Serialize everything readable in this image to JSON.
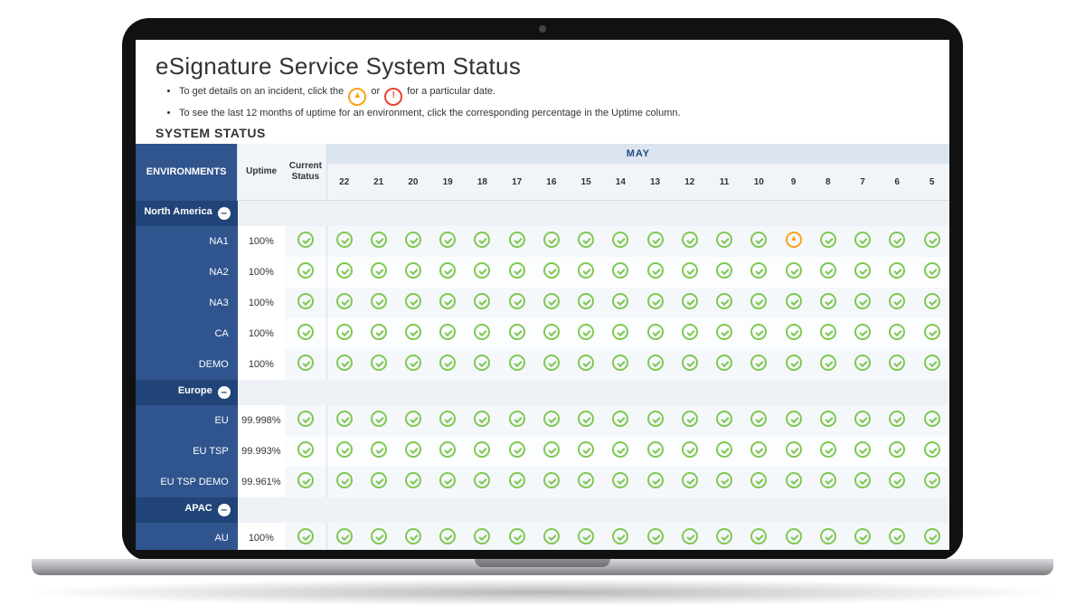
{
  "title": "eSignature Service System Status",
  "tips": [
    {
      "before": "To get details on an incident, click the ",
      "mid": " or ",
      "after": " for a particular date."
    },
    {
      "text": "To see the last 12 months of uptime for an environment, click the corresponding percentage in the Uptime column."
    }
  ],
  "section_label": "SYSTEM STATUS",
  "headers": {
    "environments": "ENVIRONMENTS",
    "uptime": "Uptime",
    "current_status": "Current Status",
    "month": "MAY"
  },
  "days": [
    "22",
    "21",
    "20",
    "19",
    "18",
    "17",
    "16",
    "15",
    "14",
    "13",
    "12",
    "11",
    "10",
    "9",
    "8",
    "7",
    "6",
    "5"
  ],
  "icons": {
    "ok": "ok",
    "warn": "warn"
  },
  "rows": [
    {
      "type": "region",
      "label": "North America"
    },
    {
      "type": "env",
      "label": "NA1",
      "uptime": "100%",
      "current": "ok",
      "cells": [
        "ok",
        "ok",
        "ok",
        "ok",
        "ok",
        "ok",
        "ok",
        "ok",
        "ok",
        "ok",
        "ok",
        "ok",
        "ok",
        "warn",
        "ok",
        "ok",
        "ok",
        "ok"
      ]
    },
    {
      "type": "env",
      "label": "NA2",
      "uptime": "100%",
      "current": "ok",
      "cells": [
        "ok",
        "ok",
        "ok",
        "ok",
        "ok",
        "ok",
        "ok",
        "ok",
        "ok",
        "ok",
        "ok",
        "ok",
        "ok",
        "ok",
        "ok",
        "ok",
        "ok",
        "ok"
      ]
    },
    {
      "type": "env",
      "label": "NA3",
      "uptime": "100%",
      "current": "ok",
      "cells": [
        "ok",
        "ok",
        "ok",
        "ok",
        "ok",
        "ok",
        "ok",
        "ok",
        "ok",
        "ok",
        "ok",
        "ok",
        "ok",
        "ok",
        "ok",
        "ok",
        "ok",
        "ok"
      ]
    },
    {
      "type": "env",
      "label": "CA",
      "uptime": "100%",
      "current": "ok",
      "cells": [
        "ok",
        "ok",
        "ok",
        "ok",
        "ok",
        "ok",
        "ok",
        "ok",
        "ok",
        "ok",
        "ok",
        "ok",
        "ok",
        "ok",
        "ok",
        "ok",
        "ok",
        "ok"
      ]
    },
    {
      "type": "env",
      "label": "DEMO",
      "uptime": "100%",
      "current": "ok",
      "cells": [
        "ok",
        "ok",
        "ok",
        "ok",
        "ok",
        "ok",
        "ok",
        "ok",
        "ok",
        "ok",
        "ok",
        "ok",
        "ok",
        "ok",
        "ok",
        "ok",
        "ok",
        "ok"
      ]
    },
    {
      "type": "region",
      "label": "Europe"
    },
    {
      "type": "env",
      "label": "EU",
      "uptime": "99.998%",
      "current": "ok",
      "cells": [
        "ok",
        "ok",
        "ok",
        "ok",
        "ok",
        "ok",
        "ok",
        "ok",
        "ok",
        "ok",
        "ok",
        "ok",
        "ok",
        "ok",
        "ok",
        "ok",
        "ok",
        "ok"
      ]
    },
    {
      "type": "env",
      "label": "EU TSP",
      "uptime": "99.993%",
      "current": "ok",
      "cells": [
        "ok",
        "ok",
        "ok",
        "ok",
        "ok",
        "ok",
        "ok",
        "ok",
        "ok",
        "ok",
        "ok",
        "ok",
        "ok",
        "ok",
        "ok",
        "ok",
        "ok",
        "ok"
      ]
    },
    {
      "type": "env",
      "label": "EU TSP DEMO",
      "uptime": "99.961%",
      "current": "ok",
      "cells": [
        "ok",
        "ok",
        "ok",
        "ok",
        "ok",
        "ok",
        "ok",
        "ok",
        "ok",
        "ok",
        "ok",
        "ok",
        "ok",
        "ok",
        "ok",
        "ok",
        "ok",
        "ok"
      ]
    },
    {
      "type": "region",
      "label": "APAC"
    },
    {
      "type": "env",
      "label": "AU",
      "uptime": "100%",
      "current": "ok",
      "cells": [
        "ok",
        "ok",
        "ok",
        "ok",
        "ok",
        "ok",
        "ok",
        "ok",
        "ok",
        "ok",
        "ok",
        "ok",
        "ok",
        "ok",
        "ok",
        "ok",
        "ok",
        "ok"
      ]
    }
  ]
}
